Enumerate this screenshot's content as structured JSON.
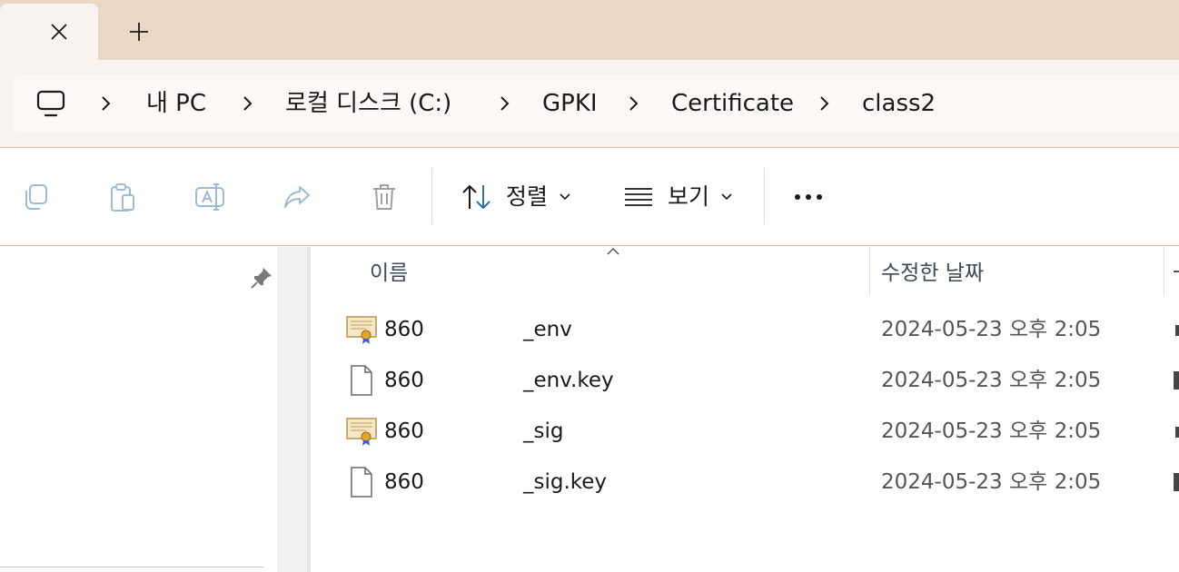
{
  "tabs": {
    "close_glyph": "✕",
    "new_tab_glyph": "+"
  },
  "breadcrumb": {
    "items": [
      "내 PC",
      "로컬 디스크 (C:)",
      "GPKI",
      "Certificate",
      "class2"
    ],
    "separator": "›"
  },
  "commands": {
    "copy": "copy-icon",
    "paste": "paste-icon",
    "rename": "rename-icon",
    "share": "share-icon",
    "delete": "trash-icon",
    "sort_label": "정렬",
    "view_label": "보기",
    "more": "•••"
  },
  "columns": {
    "name": "이름",
    "modified": "수정한 날짜"
  },
  "files": [
    {
      "name": "860",
      "suffix": "_env",
      "date": "2024-05-23 오후 2:05",
      "icon": "certificate-icon"
    },
    {
      "name": "860",
      "suffix": "_env.key",
      "date": "2024-05-23 오후 2:05",
      "icon": "file-icon"
    },
    {
      "name": "860",
      "suffix": "_sig",
      "date": "2024-05-23 오후 2:05",
      "icon": "certificate-icon"
    },
    {
      "name": "860",
      "suffix": "_sig.key",
      "date": "2024-05-23 오후 2:05",
      "icon": "file-icon"
    }
  ],
  "colors": {
    "tabstrip": "#e8d9c6",
    "toolbar_bg": "#f8f3ef",
    "accent_blue": "#2f6fb7",
    "disabled_icon": "#9fbad6"
  }
}
